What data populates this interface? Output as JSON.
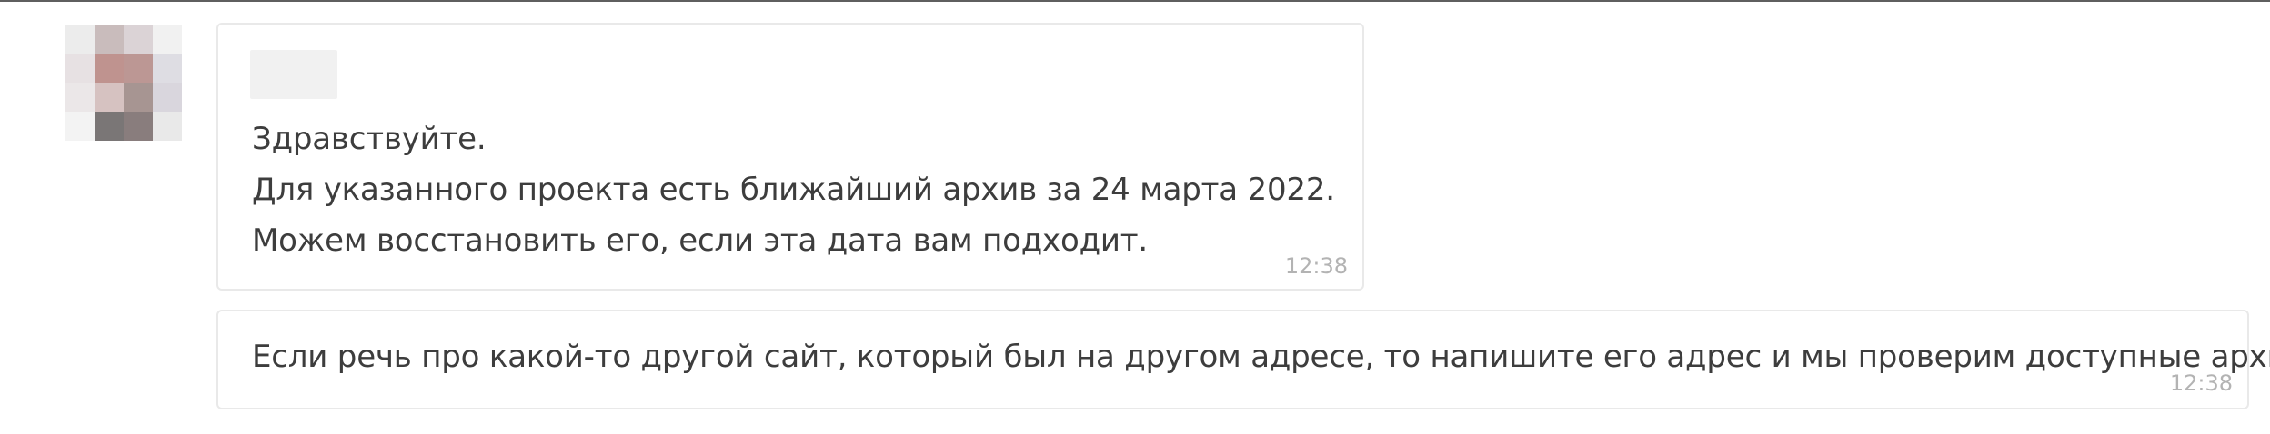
{
  "messages": [
    {
      "lines": [
        "Здравствуйте.",
        "Для указанного проекта есть ближайший архив за 24 марта 2022.",
        "Можем восстановить его, если эта дата вам подходит."
      ],
      "time": "12:38"
    },
    {
      "lines": [
        "Если речь про какой-то другой сайт, который был на другом адресе, то напишите его адрес и мы проверим доступные архивы."
      ],
      "time": "12:38"
    }
  ]
}
